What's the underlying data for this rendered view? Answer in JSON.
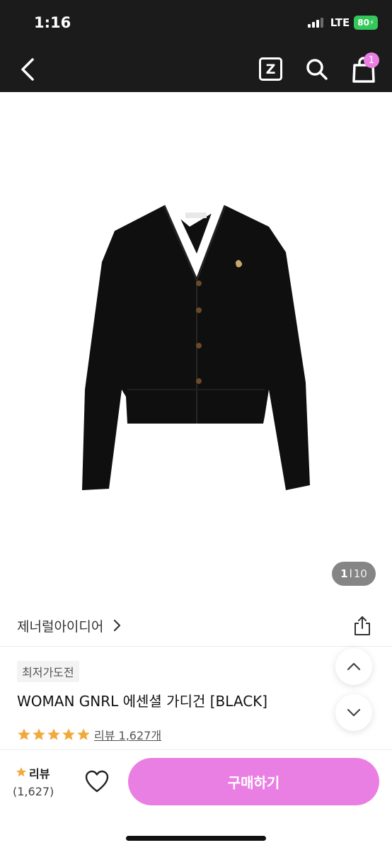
{
  "status_bar": {
    "time": "1:16",
    "network": "LTE",
    "battery": "80"
  },
  "nav": {
    "z_label": "Z",
    "cart_count": "1"
  },
  "gallery": {
    "current": "1",
    "separator": "l",
    "total": "10"
  },
  "brand": {
    "name": "제너럴아이디어"
  },
  "product": {
    "tag": "최저가도전",
    "title": "WOMAN GNRL 에센셜 가디건 [BLACK]",
    "rating_stars": 5,
    "review_link": "리뷰 1,627개"
  },
  "bottom_bar": {
    "review_label": "리뷰",
    "review_count": "(1,627)",
    "buy_label": "구매하기"
  },
  "colors": {
    "accent": "#ea7fe3",
    "star": "#f2a93b",
    "topbar": "#1b1b1b"
  }
}
